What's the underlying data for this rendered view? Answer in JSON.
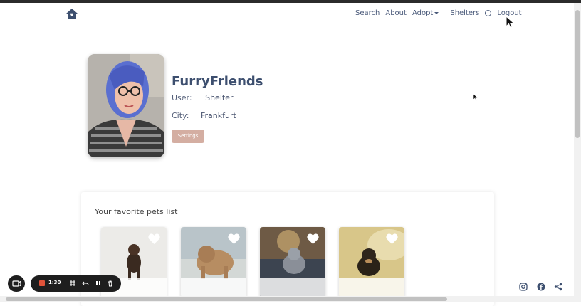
{
  "nav": {
    "links": [
      "Search",
      "About",
      "Adopt",
      "Shelters",
      "Logout"
    ],
    "icons": {
      "home": "home-icon",
      "account": "user-circle-icon"
    }
  },
  "profile": {
    "name": "FurryFriends",
    "user_label": "User:",
    "user_value": "Shelter",
    "city_label": "City:",
    "city_value": "Frankfurt",
    "settings_label": "Settings",
    "settings_color": "#d4aea2"
  },
  "favorites": {
    "title": "Your favorite pets list",
    "pets": [
      {
        "name": "pet-card-1",
        "icon": "heart-icon"
      },
      {
        "name": "pet-card-2",
        "icon": "heart-icon"
      },
      {
        "name": "pet-card-3",
        "icon": "heart-icon"
      },
      {
        "name": "pet-card-4",
        "icon": "heart-icon"
      }
    ]
  },
  "recorder": {
    "time": "1:30",
    "icons": [
      "camera-icon",
      "stop-icon",
      "grid-icon",
      "undo-icon",
      "pause-icon",
      "trash-icon"
    ],
    "stop_color": "#e0533a"
  },
  "social": {
    "icons": [
      "instagram-icon",
      "facebook-icon",
      "share-icon"
    ]
  },
  "colors": {
    "nav_text": "#4a5a7a",
    "title": "#3d4f6f"
  }
}
